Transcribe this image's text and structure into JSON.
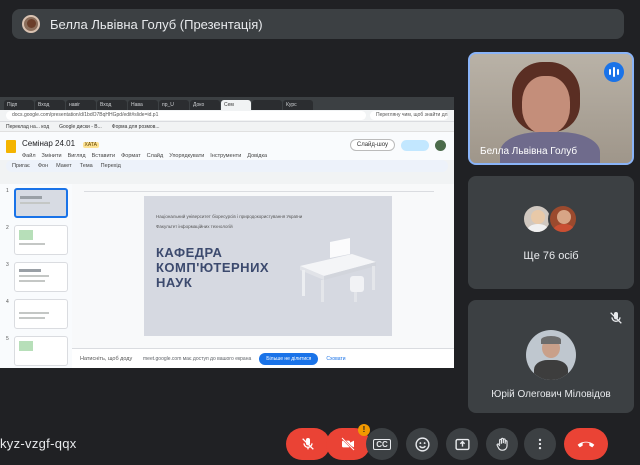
{
  "presenter_bar": {
    "title": "Белла Львівна Голуб (Презентація)"
  },
  "shared_screen": {
    "browser_tabs": [
      "Підп",
      "Вход",
      "навіг",
      "Вход",
      "Нава",
      "пр_U",
      "Доко",
      "Сем",
      "",
      "Курс"
    ],
    "address": "docs.google.com/presentation/d/1bdO7BqHHGpd/edit#slide=id.p1",
    "bookmarks": [
      "Переклад на... код",
      "Google диски - В...",
      "Форма для розмов..."
    ],
    "search_hint": "Перегляну чим, щоб знайти для",
    "doc_title": "Семінар 24.01",
    "doc_badge": "ХАТА",
    "menu": [
      "Файл",
      "Змінити",
      "Вигляд",
      "Вставити",
      "Формат",
      "Слайд",
      "Упорядкувати",
      "Інструменти",
      "Довідка"
    ],
    "slideshow_label": "Слайд-шоу",
    "toolbar": [
      "Пригає",
      "Фон",
      "Макет",
      "Тема",
      "Перехід"
    ],
    "thumb_numbers": [
      "1",
      "2",
      "3",
      "4",
      "5"
    ],
    "slide": {
      "university": "Національний університет біоресурсів і природокористування України",
      "faculty": "Факультет інформаційних технологій",
      "title_line1": "КАФЕДРА",
      "title_line2": "КОМП'ЮТЕРНИХ",
      "title_line3": "НАУК"
    },
    "notes_label": "Натисніть, щоб доду",
    "share_message": "meet.google.com має доступ до вашого екрана",
    "share_stop": "Більше не ділитися",
    "share_hide": "Сховати"
  },
  "tiles": {
    "camera_name": "Белла Львівна Голуб",
    "more_label": "Ще 76 осіб",
    "participant_name": "Юрій Олегович Міловідов"
  },
  "bottom_bar": {
    "meeting_code": "kyz-vzgf-qqx",
    "camera_badge": "!",
    "cc_label": "CC"
  },
  "icons": {
    "mic": "mic-off-icon",
    "camera": "camera-off-icon",
    "captions": "captions-icon",
    "emoji": "emoji-icon",
    "present": "present-screen-icon",
    "hand": "raise-hand-icon",
    "more": "more-vert-icon",
    "end": "end-call-icon"
  },
  "colors": {
    "background": "#202124",
    "tile": "#3c4043",
    "end_call": "#ea4335",
    "accent": "#1a73e8",
    "badge": "#f29900"
  }
}
